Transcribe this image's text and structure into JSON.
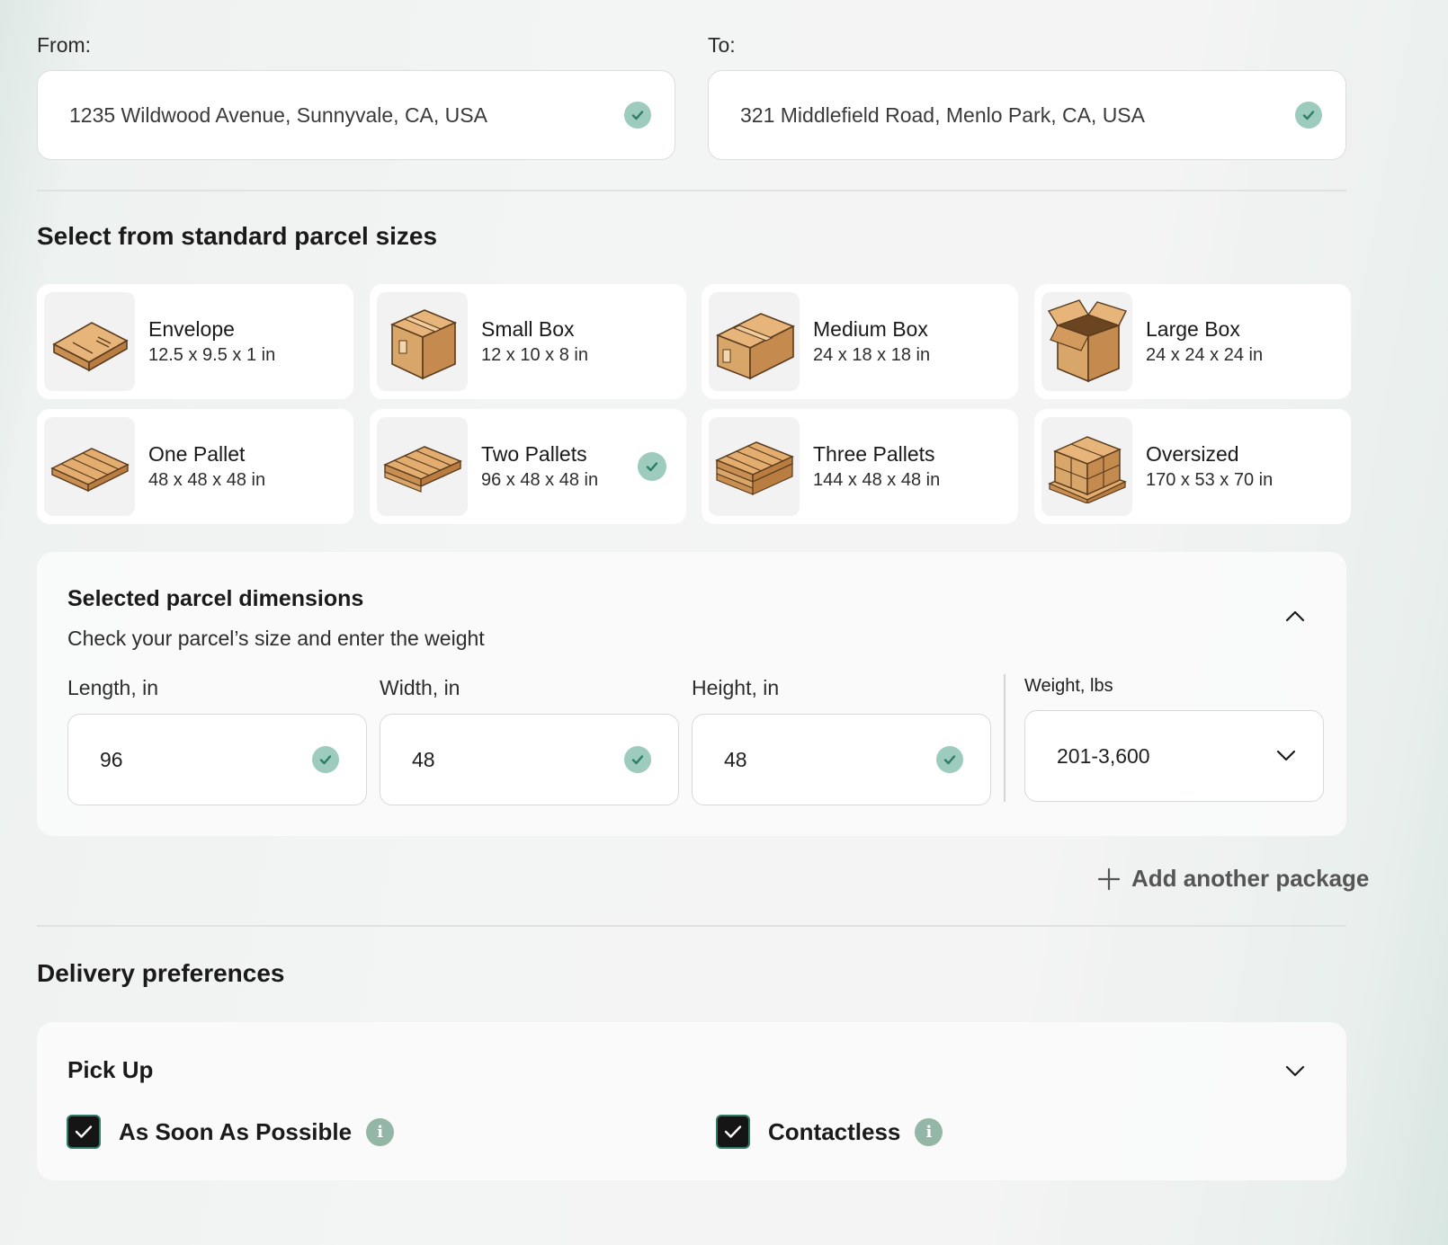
{
  "route": {
    "from_label": "From:",
    "from_value": "1235 Wildwood Avenue, Sunnyvale, CA, USA",
    "to_label": "To:",
    "to_value": "321 Middlefield Road, Menlo Park, CA, USA"
  },
  "parcels": {
    "title": "Select from standard parcel sizes",
    "items": [
      {
        "name": "Envelope",
        "dims": "12.5 x 9.5 x 1 in",
        "icon": "envelope-icon",
        "selected": false
      },
      {
        "name": "Small Box",
        "dims": "12 x 10 x 8 in",
        "icon": "small-box-icon",
        "selected": false
      },
      {
        "name": "Medium Box",
        "dims": "24 x 18 x 18 in",
        "icon": "medium-box-icon",
        "selected": false
      },
      {
        "name": "Large Box",
        "dims": "24 x 24 x 24 in",
        "icon": "large-box-icon",
        "selected": false
      },
      {
        "name": "One Pallet",
        "dims": "48 x 48 x 48 in",
        "icon": "pallet-icon",
        "selected": false
      },
      {
        "name": "Two Pallets",
        "dims": "96 x 48 x 48 in",
        "icon": "two-pallets-icon",
        "selected": true
      },
      {
        "name": "Three Pallets",
        "dims": "144 x 48 x 48 in",
        "icon": "three-pallets-icon",
        "selected": false
      },
      {
        "name": "Oversized",
        "dims": "170 x 53 x 70 in",
        "icon": "oversized-icon",
        "selected": false
      }
    ]
  },
  "dimensions": {
    "title": "Selected parcel dimensions",
    "subtitle": "Check your parcel’s size and enter the weight",
    "length_label": "Length, in",
    "length_value": "96",
    "width_label": "Width, in",
    "width_value": "48",
    "height_label": "Height, in",
    "height_value": "48",
    "weight_label": "Weight, lbs",
    "weight_value": "201-3,600"
  },
  "add_package_label": "Add another package",
  "delivery": {
    "title": "Delivery preferences",
    "pickup_title": "Pick Up",
    "asap_label": "As Soon As Possible",
    "asap_checked": true,
    "contactless_label": "Contactless",
    "contactless_checked": true
  },
  "colors": {
    "accent_check": "#9dcbbd",
    "checkmark": "#2e7d67",
    "cardboard": "#d9a66a",
    "info": "#94b6a6"
  }
}
